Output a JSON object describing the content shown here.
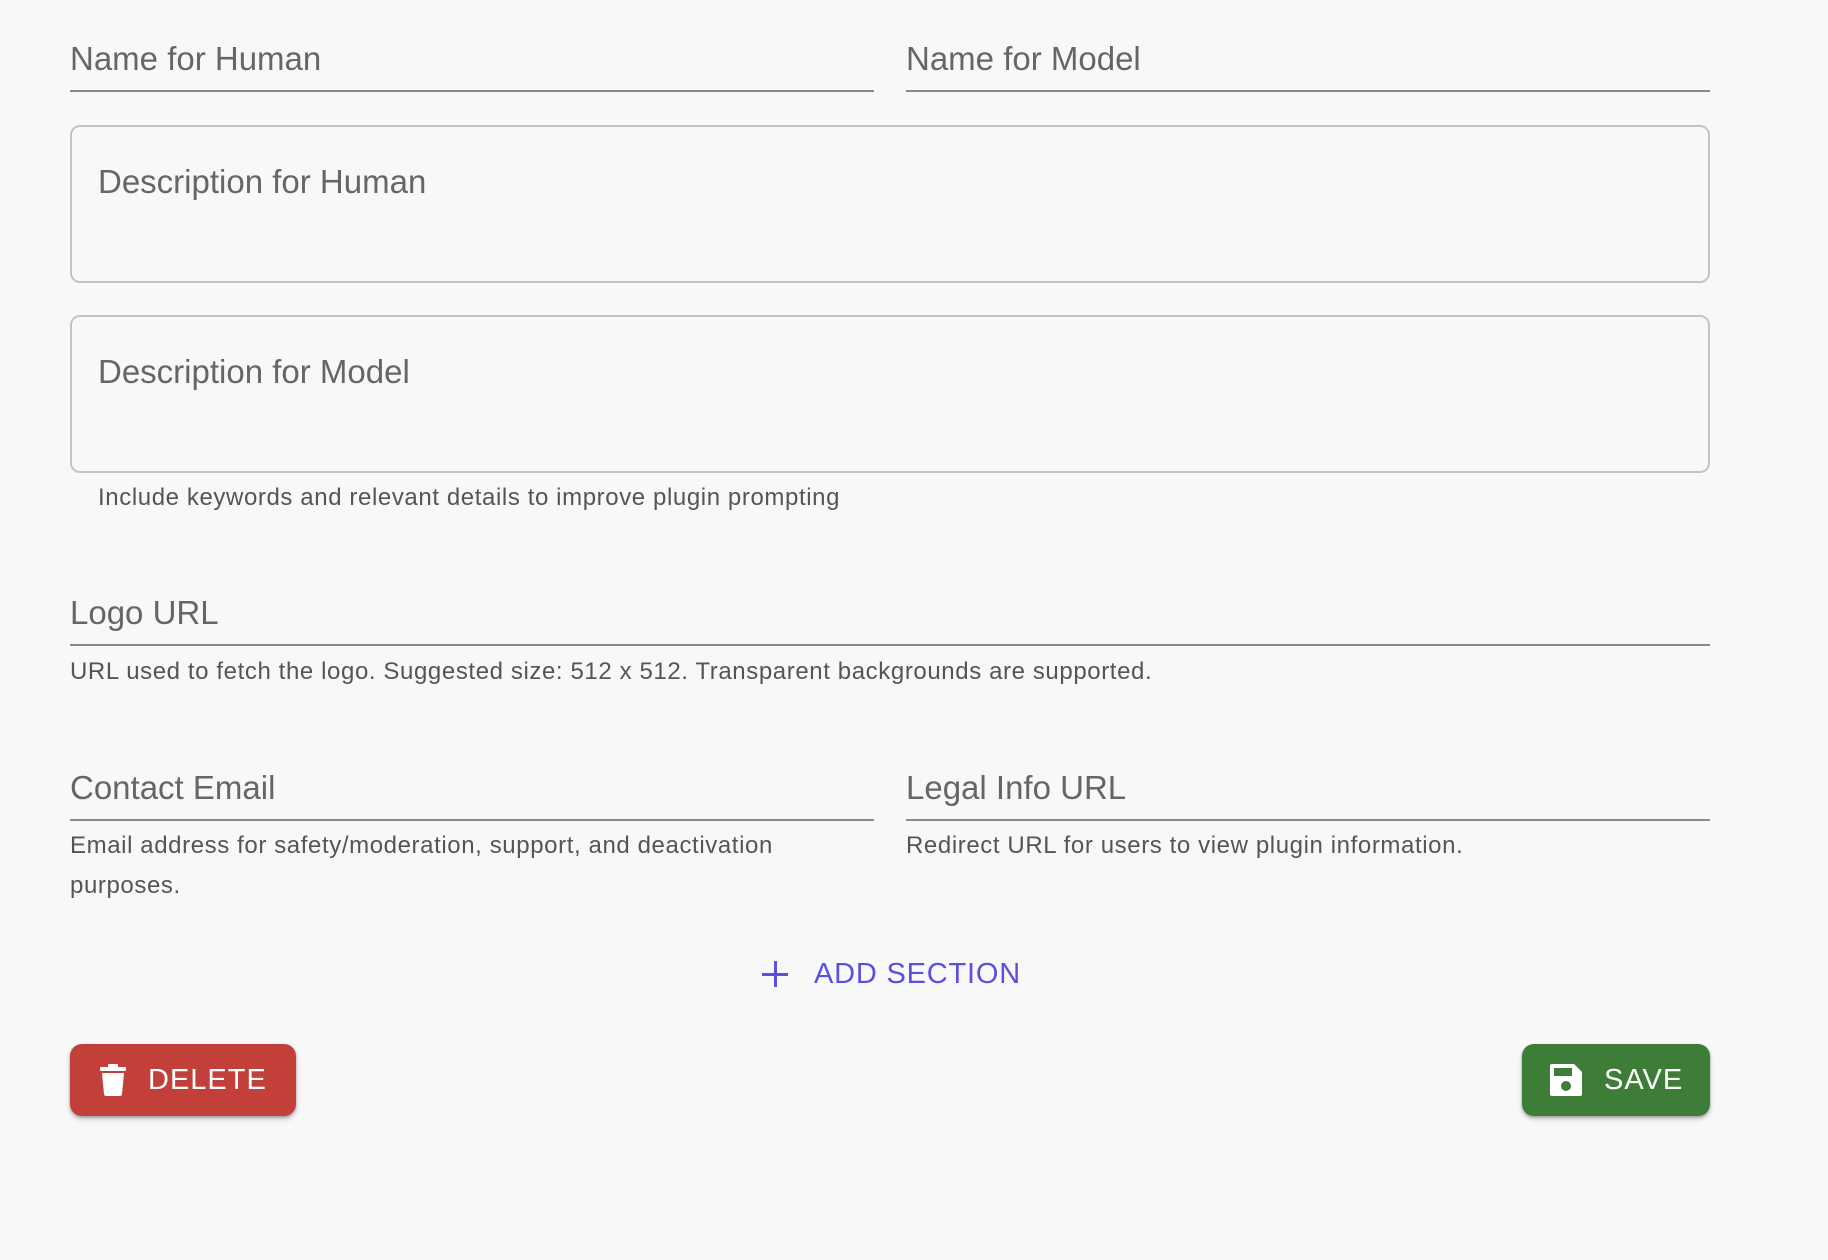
{
  "form": {
    "name_for_human": {
      "label": "Name for Human"
    },
    "name_for_model": {
      "label": "Name for Model"
    },
    "description_for_human": {
      "label": "Description for Human"
    },
    "description_for_model": {
      "label": "Description for Model",
      "helper": "Include keywords and relevant details to improve plugin prompting"
    },
    "logo_url": {
      "label": "Logo URL",
      "helper": "URL used to fetch the logo. Suggested size: 512 x 512. Transparent backgrounds are supported."
    },
    "contact_email": {
      "label": "Contact Email",
      "helper": "Email address for safety/moderation, support, and deactivation purposes."
    },
    "legal_info_url": {
      "label": "Legal Info URL",
      "helper": "Redirect URL for users to view plugin information."
    }
  },
  "actions": {
    "add_section_label": "ADD SECTION",
    "delete_label": "DELETE",
    "save_label": "SAVE"
  },
  "colors": {
    "background": "#f8f8f8",
    "accent": "#5b4fe0",
    "delete": "#c3403a",
    "save": "#3e7d37"
  },
  "icons": {
    "add": "plus-icon",
    "delete": "trash-icon",
    "save": "floppy-disk-icon"
  }
}
